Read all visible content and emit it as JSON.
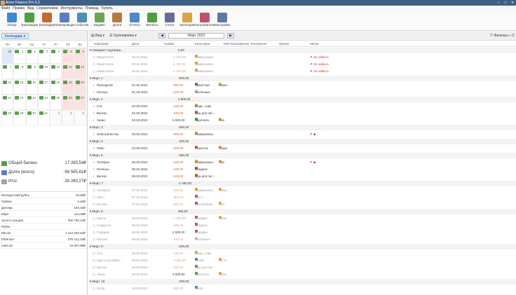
{
  "window": {
    "title": "Alzex Finance Pro 6.2"
  },
  "menu": [
    "Файл",
    "Правка",
    "Вид",
    "Справочники",
    "Инструменты",
    "Помощь",
    "Купить"
  ],
  "toolbar": [
    {
      "label": "Обзор",
      "icon": "overview-icon",
      "color": "#3c8ad0"
    },
    {
      "label": "Транзакции",
      "icon": "transactions-icon",
      "color": "#4f9e3f"
    },
    {
      "label": "Календарь",
      "icon": "calendar-icon",
      "color": "#c46a2c"
    },
    {
      "label": "Планировщик",
      "icon": "scheduler-icon",
      "color": "#5b7cbf"
    },
    {
      "label": "События",
      "icon": "events-icon",
      "color": "#4a8fb4"
    },
    {
      "label": "Бюджет",
      "icon": "budget-icon",
      "color": "#6aa84f"
    },
    {
      "label": "Долги",
      "icon": "debts-icon",
      "color": "#b47a3c"
    },
    {
      "label": "Отчеты",
      "icon": "reports-icon",
      "color": "#4b89c7"
    },
    {
      "label": "Валюты",
      "icon": "currencies-icon",
      "color": "#4f9e3f"
    },
    {
      "label": "Счета",
      "icon": "accounts-icon",
      "color": "#6a6a9a"
    },
    {
      "label": "Категории",
      "icon": "categories-icon",
      "color": "#d9a441"
    },
    {
      "label": "Пользователи",
      "icon": "users-icon",
      "color": "#c0506e"
    },
    {
      "label": "Настройки",
      "icon": "settings-icon",
      "color": "#5a7aa5"
    }
  ],
  "left": {
    "view_label": "Календарь",
    "weekdays": [
      "Пн",
      "Вт",
      "Ср",
      "Чт",
      "Пт",
      "Сб",
      "Вс"
    ],
    "weeks": [
      [
        "28",
        "1",
        "2",
        "3",
        "4",
        "5",
        "6"
      ],
      [
        "7",
        "8",
        "9",
        "10",
        "11",
        "12",
        "13"
      ],
      [
        "14",
        "15",
        "16",
        "17",
        "18",
        "19",
        "20"
      ],
      [
        "21",
        "22",
        "23",
        "24",
        "25",
        "26",
        "27"
      ],
      [
        "28",
        "29",
        "30",
        "31",
        "1",
        "2",
        "3"
      ]
    ],
    "balances": [
      {
        "label": "Общий баланс",
        "value": "17 285,54₽",
        "color": "#4f9e3f"
      },
      {
        "label": "Долги (всего)",
        "value": "-56 565,81₽",
        "color": "#5b7cbf"
      },
      {
        "label": "Итог",
        "value": "-39 280,27₽",
        "color": "#9aa5b0"
      }
    ],
    "rates": [
      {
        "label": "Белорусский рубль",
        "value": "33,55₽"
      },
      {
        "label": "Гривна",
        "value": "3,46₽"
      },
      {
        "label": "Доллар",
        "value": "104,40₽"
      },
      {
        "label": "Евро",
        "value": "114,08₽"
      },
      {
        "label": "Золото (унция)",
        "value": "205 730,44₽"
      },
      {
        "label": "Рубль",
        "value": ""
      },
      {
        "label": "Bitcoin",
        "value": "4 112 320,54₽"
      },
      {
        "label": "Etherium",
        "value": "276 312,34₽"
      },
      {
        "label": "LiteCoin",
        "value": "10 307,99₽"
      }
    ]
  },
  "main": {
    "view_btn": "Вид",
    "group_btn": "Группировка",
    "period": "Март 2022",
    "filters": "Фильтры",
    "columns": [
      "Описание",
      "Дата",
      "Сумма",
      "Категория",
      "Чей пользователь",
      "Контрагент",
      "Проект",
      "Метки"
    ],
    "rows": [
      {
        "type": "group",
        "desc": "Ожидают подтверж...",
        "amount": "0,00"
      },
      {
        "type": "plan",
        "desc": "Квартплата",
        "date": "20.12.2021",
        "amount": "-1 000,00",
        "cat": "Коммуналка",
        "cc": "#e0a22a",
        "mark": "✗ Не забыть"
      },
      {
        "type": "plan",
        "desc": "Квартплата",
        "date": "20.01.2022",
        "amount": "-1 000,00",
        "cat": "Коммуналка",
        "cc": "#e0a22a",
        "mark": "✗ Не забыть"
      },
      {
        "type": "plan",
        "desc": "Квартплата",
        "date": "20.02.2022",
        "amount": "-1 000,00",
        "cat": "Коммуналка",
        "cc": "#e0a22a",
        "mark": "✗ Не забыть"
      },
      {
        "type": "group",
        "desc": "Март, 1",
        "amount": "-600,00"
      },
      {
        "type": "done",
        "desc": "Проездной",
        "date": "01.03.2022",
        "amount": "-500,00",
        "cat": "Транспорт",
        "cc": "#5a7aa5",
        "user": "Саша"
      },
      {
        "type": "done",
        "desc": "Молоко",
        "date": "01.03.2022",
        "amount": "-100,00",
        "cat": "Молочные",
        "cc": "#cccccc"
      },
      {
        "type": "group",
        "desc": "Март, 2",
        "amount": "4 800,00"
      },
      {
        "type": "done",
        "desc": "Сок",
        "date": "02.03.2022",
        "amount": "-100,00",
        "cat": "Воды, соки",
        "cc": "#e0a22a"
      },
      {
        "type": "done",
        "desc": "Вискас",
        "date": "02.03.2022",
        "amount": "-100,00",
        "cat": "Еда для пит...",
        "cc": "#d4622c"
      },
      {
        "type": "done",
        "desc": "Аванс",
        "date": "02.03.2022",
        "amount": "5 000,00",
        "cat": "Зарплата",
        "cc": "#4f9e3f",
        "user": "Аня",
        "pos": true
      },
      {
        "type": "group",
        "desc": "Март, 3",
        "amount": "-300,00"
      },
      {
        "type": "done",
        "desc": "Электричество",
        "date": "03.03.2022",
        "amount": "-300,00",
        "cat": "Коммуналка",
        "cc": "#e0a22a",
        "mark": "✗ ◆"
      },
      {
        "type": "group",
        "desc": "Март, 4",
        "amount": "-200,00"
      },
      {
        "type": "done",
        "desc": "Пиво",
        "date": "04.03.2022",
        "amount": "-200,00",
        "cat": "Алкоголь",
        "cc": "#d4622c",
        "user": "Саша"
      },
      {
        "type": "group",
        "desc": "Март, 5",
        "amount": "-400,00"
      },
      {
        "type": "done",
        "desc": "Телефон",
        "date": "05.03.2022",
        "amount": "-200,00",
        "cat": "Коммуналка",
        "cc": "#e0a22a",
        "user": "Аня",
        "mark": "✗ ◆"
      },
      {
        "type": "done",
        "desc": "Печенье",
        "date": "05.03.2022",
        "amount": "-100,00",
        "cat": "Сладкое",
        "cc": "#c94a4a"
      },
      {
        "type": "done",
        "desc": "Вискас",
        "date": "05.03.2022",
        "amount": "-100,00",
        "cat": "Еда для пит...",
        "cc": "#d4622c"
      },
      {
        "type": "group",
        "desc": "Март, 7",
        "amount": "-1 050,00"
      },
      {
        "type": "plan",
        "desc": "Телефон",
        "date": "07.03.2022",
        "amount": "-250,00",
        "cat": "Коммуналка",
        "cc": "#e0a22a",
        "user": "Саша"
      },
      {
        "type": "plan",
        "desc": "Мясо",
        "date": "07.03.2022",
        "amount": "-300,00",
        "cat": "Мясо",
        "cc": "#c94a4a"
      },
      {
        "type": "plan",
        "desc": "Бензин",
        "date": "07.03.2022",
        "amount": "-500,00",
        "cat": "Автомобиль",
        "cc": "#c94a4a",
        "user": "Аня"
      },
      {
        "type": "group",
        "desc": "Март, 8",
        "amount": "800,00"
      },
      {
        "type": "plan",
        "desc": "Цветы",
        "date": "08.03.2022",
        "amount": "-1 000,00",
        "cat": "Подарки",
        "cc": "#c94a4a",
        "user": "Саша"
      },
      {
        "type": "plan",
        "desc": "Сладости",
        "date": "08.03.2022",
        "amount": "-100,00",
        "cat": "Сладкое",
        "cc": "#c94a4a"
      },
      {
        "type": "plan",
        "desc": "Подарок",
        "date": "08.03.2022",
        "amount": "2 000,00",
        "cat": "Подарки",
        "cc": "#c94a4a",
        "pos": true
      },
      {
        "type": "plan",
        "desc": "Молоко",
        "date": "08.03.2022",
        "amount": "-100,00",
        "cat": "Молочные",
        "cc": "#cccccc"
      },
      {
        "type": "group",
        "desc": "Март, 9",
        "amount": "-200,00"
      },
      {
        "type": "plan",
        "desc": "Сок",
        "date": "09.03.2022",
        "amount": "-100,00",
        "cat": "Воды, соки",
        "cc": "#e0a22a"
      },
      {
        "type": "plan",
        "desc": "Курсы английск...",
        "date": "09.03.2022",
        "amount": "-2 000,00",
        "cat": "Учеба",
        "cc": "#5a7aa5",
        "user": "Костя"
      },
      {
        "type": "plan",
        "desc": "Вискас",
        "date": "09.03.2022",
        "amount": "-100,00",
        "cat": "Еда для пит...",
        "cc": "#d4622c"
      },
      {
        "type": "plan",
        "desc": "Аванс",
        "date": "09.03.2022",
        "amount": "3 000,00",
        "cat": "Зарплата",
        "cc": "#4f9e3f",
        "user": "Саша",
        "pos": true
      },
      {
        "type": "group",
        "desc": "Март, 10",
        "amount": "-200,00"
      },
      {
        "type": "plan",
        "desc": "Рыба",
        "date": "10.03.2022",
        "amount": "-200,00",
        "cat": "Рыба",
        "cc": "#5a7aa5"
      }
    ]
  }
}
